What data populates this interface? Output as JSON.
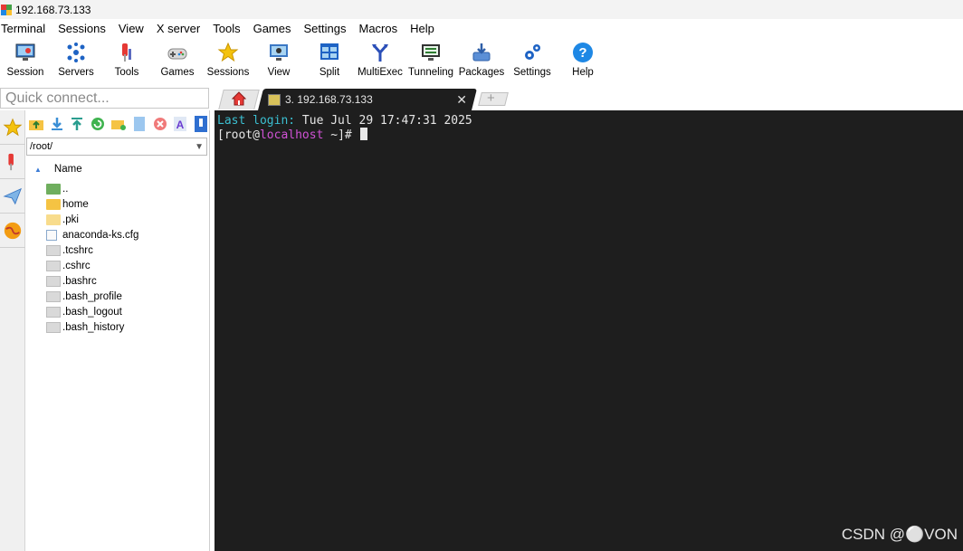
{
  "window": {
    "title": "192.168.73.133"
  },
  "menu": [
    "Terminal",
    "Sessions",
    "View",
    "X server",
    "Tools",
    "Games",
    "Settings",
    "Macros",
    "Help"
  ],
  "toolbar": [
    {
      "label": "Session",
      "icon": "monitor-icon"
    },
    {
      "label": "Servers",
      "icon": "servers-icon"
    },
    {
      "label": "Tools",
      "icon": "tools-icon"
    },
    {
      "label": "Games",
      "icon": "gamepad-icon"
    },
    {
      "label": "Sessions",
      "icon": "star-icon"
    },
    {
      "label": "View",
      "icon": "view-icon"
    },
    {
      "label": "Split",
      "icon": "split-icon"
    },
    {
      "label": "MultiExec",
      "icon": "multiexec-icon"
    },
    {
      "label": "Tunneling",
      "icon": "tunneling-icon"
    },
    {
      "label": "Packages",
      "icon": "packages-icon"
    },
    {
      "label": "Settings",
      "icon": "gears-icon"
    },
    {
      "label": "Help",
      "icon": "help-icon"
    }
  ],
  "quick_connect": {
    "placeholder": "Quick connect..."
  },
  "tabs": {
    "active_label": "3. 192.168.73.133",
    "close": "✕",
    "new": "+"
  },
  "sidebar": {
    "path": "/root/",
    "column_name": "Name",
    "files": [
      {
        "name": "..",
        "type": "up"
      },
      {
        "name": "home",
        "type": "folder"
      },
      {
        "name": ".pki",
        "type": "folder-light"
      },
      {
        "name": "anaconda-ks.cfg",
        "type": "cfg"
      },
      {
        "name": ".tcshrc",
        "type": "file"
      },
      {
        "name": ".cshrc",
        "type": "file"
      },
      {
        "name": ".bashrc",
        "type": "file"
      },
      {
        "name": ".bash_profile",
        "type": "file"
      },
      {
        "name": ".bash_logout",
        "type": "file"
      },
      {
        "name": ".bash_history",
        "type": "file"
      }
    ]
  },
  "terminal": {
    "login_label": "Last login:",
    "login_value": " Tue Jul 29 17:47:31 2025",
    "prompt_open": "[root@",
    "prompt_host": "localhost",
    "prompt_close": " ~]# "
  },
  "watermark": "CSDN @⚪VON",
  "colors": {
    "terminal_bg": "#1e1e1e",
    "accent_cyan": "#3bbfd1",
    "accent_magenta": "#d152d6"
  }
}
